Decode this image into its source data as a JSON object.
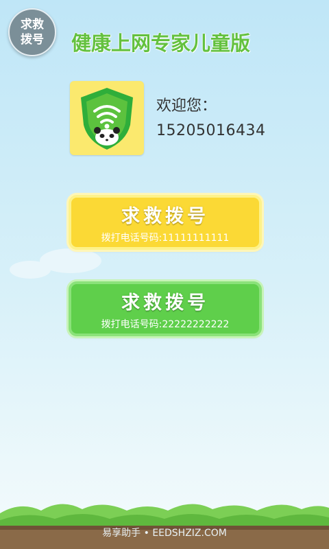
{
  "sos_button": {
    "line1": "求救",
    "line2": "拨号"
  },
  "app_title": "健康上网专家儿童版",
  "user": {
    "welcome": "欢迎您：",
    "phone": "15205016434"
  },
  "buttons": [
    {
      "label": "求救拨号",
      "sub": "拨打电话号码:11111111111"
    },
    {
      "label": "求救拨号",
      "sub": "拨打电话号码:22222222222"
    }
  ],
  "watermark": "易享助手 • EEDSHZIZ.COM",
  "colors": {
    "title": "#63c13e",
    "yellow_button": "#fbd935",
    "green_button": "#5fcf4b",
    "shield": "#2fae3a"
  }
}
